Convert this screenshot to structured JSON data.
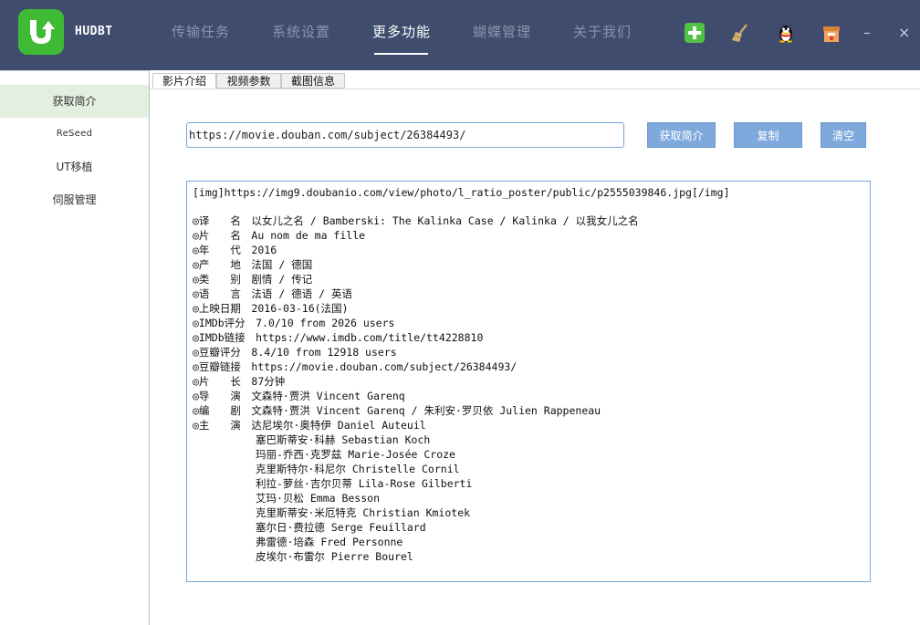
{
  "app": {
    "name": "HUDBT"
  },
  "nav": [
    {
      "label": "传输任务",
      "active": false
    },
    {
      "label": "系统设置",
      "active": false
    },
    {
      "label": "更多功能",
      "active": true
    },
    {
      "label": "蝴蝶管理",
      "active": false
    },
    {
      "label": "关于我们",
      "active": false
    }
  ],
  "toolbar": {
    "icons": [
      "add-icon",
      "broom-icon",
      "qq-penguin-icon",
      "gift-box-icon"
    ],
    "minimize": "–",
    "close": "×"
  },
  "sidebar": {
    "items": [
      {
        "label": "获取简介",
        "active": true
      },
      {
        "label": "ReSeed",
        "active": false
      },
      {
        "label": "UT移植",
        "active": false
      },
      {
        "label": "伺服管理",
        "active": false
      }
    ]
  },
  "tabs": [
    {
      "label": "影片介绍",
      "active": true
    },
    {
      "label": "视频参数",
      "active": false
    },
    {
      "label": "截图信息",
      "active": false
    }
  ],
  "url_field": {
    "value": "https://movie.douban.com/subject/26384493/"
  },
  "buttons": {
    "fetch": "获取简介",
    "copy": "复制",
    "clear": "清空"
  },
  "colors": {
    "titlebar": "#3f4c6e",
    "accent_green": "#3fba35",
    "button": "#7fa9dc",
    "sidebar_active": "#e3efdf"
  },
  "output": {
    "lines": [
      "[img]https://img9.doubanio.com/view/photo/l_ratio_poster/public/p2555039846.jpg[/img]",
      "",
      "◎译　　名　以女儿之名 / Bamberski: The Kalinka Case / Kalinka / 以我女儿之名",
      "◎片　　名　Au nom de ma fille",
      "◎年　　代　2016",
      "◎产　　地　法国 / 德国",
      "◎类　　别　剧情 / 传记",
      "◎语　　言　法语 / 德语 / 英语",
      "◎上映日期　2016-03-16(法国)",
      "◎IMDb评分　7.0/10 from 2026 users",
      "◎IMDb链接　https://www.imdb.com/title/tt4228810",
      "◎豆瓣评分　8.4/10 from 12918 users",
      "◎豆瓣链接　https://movie.douban.com/subject/26384493/",
      "◎片　　长　87分钟",
      "◎导　　演　文森特·贾洪 Vincent Garenq",
      "◎编　　剧　文森特·贾洪 Vincent Garenq / 朱利安·罗贝依 Julien Rappeneau",
      "◎主　　演　达尼埃尔·奥特伊 Daniel Auteuil",
      "　　　　　　塞巴斯蒂安·科赫 Sebastian Koch",
      "　　　　　　玛丽-乔西·克罗兹 Marie-Josée Croze",
      "　　　　　　克里斯特尔·科尼尔 Christelle Cornil",
      "　　　　　　利拉-萝丝·吉尔贝蒂 Lila-Rose Gilberti",
      "　　　　　　艾玛·贝松 Emma Besson",
      "　　　　　　克里斯蒂安·米厄特克 Christian Kmiotek",
      "　　　　　　塞尔日·费拉德 Serge Feuillard",
      "　　　　　　弗雷德·培森 Fred Personne",
      "　　　　　　皮埃尔·布雷尔 Pierre Bourel"
    ]
  }
}
